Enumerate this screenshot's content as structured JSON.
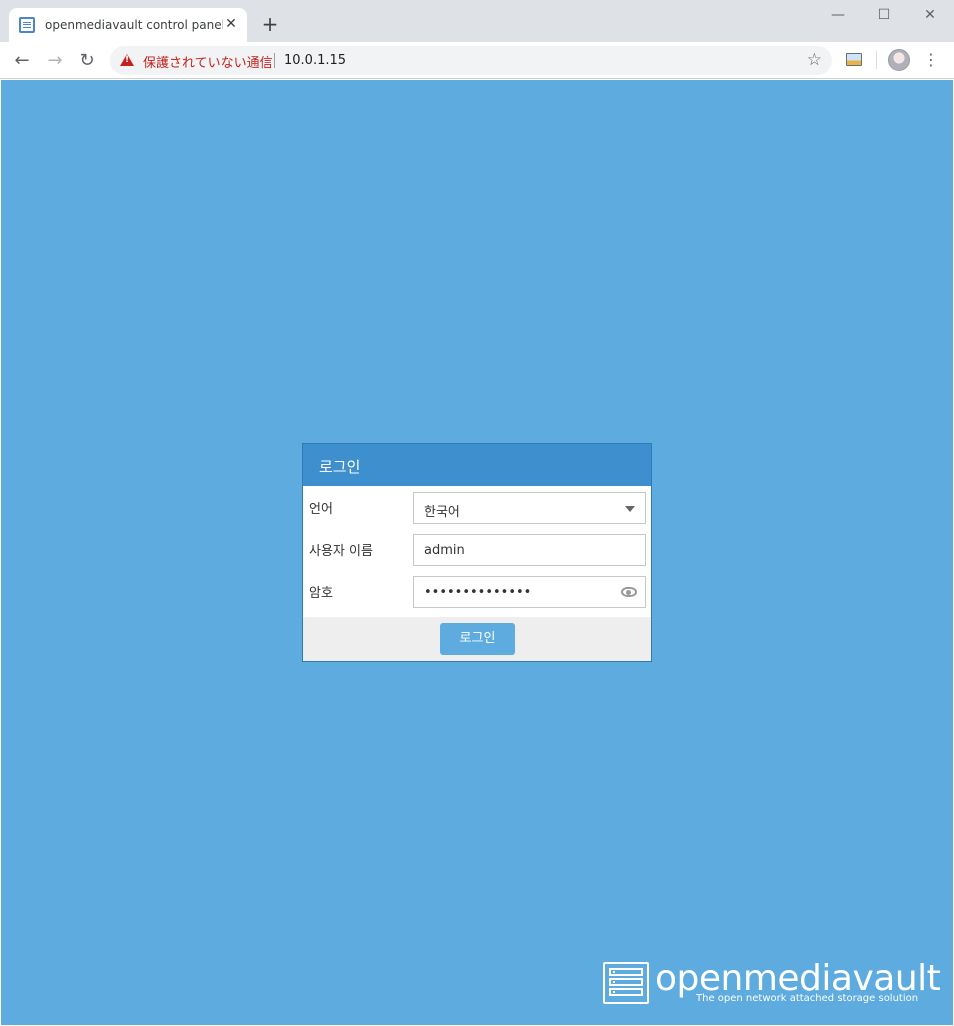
{
  "browser": {
    "tab_title": "openmediavault control panel - n",
    "tab_close": "✕",
    "new_tab": "+",
    "window": {
      "minimize": "—",
      "maximize": "☐",
      "close": "✕"
    },
    "nav": {
      "back": "←",
      "forward": "→",
      "reload": "↻"
    },
    "security_label": "保護されていない通信",
    "url": "10.0.1.15",
    "bookmark_star": "☆",
    "menu": "⋮"
  },
  "login": {
    "title": "로그인",
    "language_label": "언어",
    "language_value": "한국어",
    "username_label": "사용자 이름",
    "username_value": "admin",
    "password_label": "암호",
    "password_mask": "••••••••••••••",
    "submit_label": "로그인"
  },
  "brand": {
    "wordmark": "openmediavault",
    "tagline": "The open network attached storage solution"
  },
  "colors": {
    "page_background": "#5dabdf",
    "dialog_header": "#3d8fcd",
    "login_button": "#5dabdf",
    "security_warning": "#c5221f"
  },
  "icons": [
    "tab-favicon-icon",
    "warning-icon",
    "star-icon",
    "extension-icon",
    "avatar",
    "menu-icon",
    "dropdown-caret-icon",
    "eye-icon",
    "logo-icon"
  ]
}
